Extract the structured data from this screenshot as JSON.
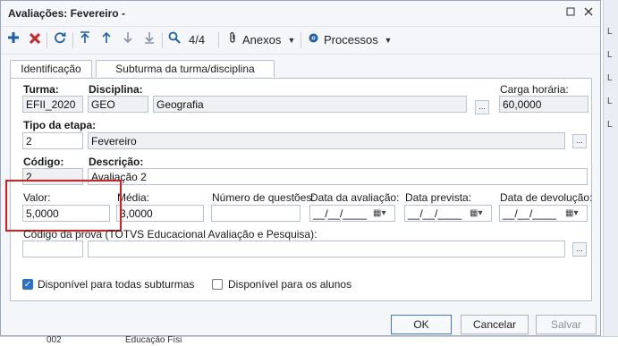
{
  "window": {
    "title": "Avaliações: Fevereiro -"
  },
  "titlebar": {
    "restore_icon": "restore-icon",
    "close_icon": "close-icon"
  },
  "toolbar": {
    "counter": "4/4",
    "anexos": "Anexos",
    "processos": "Processos"
  },
  "tabs": [
    {
      "label": "Identificação"
    },
    {
      "label": "Subturma da turma/disciplina"
    }
  ],
  "form": {
    "turma_label": "Turma:",
    "turma_value": "EFII_2020",
    "disciplina_label": "Disciplina:",
    "disciplina_code": "GEO",
    "disciplina_name": "Geografia",
    "carga_label": "Carga horária:",
    "carga_value": "60,0000",
    "tipo_label": "Tipo da etapa:",
    "tipo_code": "2",
    "tipo_name": "Fevereiro",
    "codigo_label": "Código:",
    "codigo_value": "2",
    "descricao_label": "Descrição:",
    "descricao_value": "Avaliação 2",
    "valor_label": "Valor:",
    "valor_value": "5,0000",
    "media_label": "Média:",
    "media_value": "3,0000",
    "numq_label": "Número de questões:",
    "numq_value": "",
    "data_aval_label": "Data da avaliação:",
    "data_aval_value": "__/__/____",
    "data_prev_label": "Data prevista:",
    "data_prev_value": "__/__/____",
    "data_dev_label": "Data de devolução:",
    "data_dev_value": "__/__/____",
    "codprova_label": "Código da prova (TOTVS Educacional Avaliação e Pesquisa):",
    "codprova_value": "",
    "codprova_desc": "",
    "chk_subturmas_label": "Disponível para todas subturmas",
    "chk_subturmas_checked": true,
    "chk_alunos_label": "Disponível para os alunos",
    "chk_alunos_checked": false,
    "lookup_dots": "..."
  },
  "buttons": {
    "ok": "OK",
    "cancel": "Cancelar",
    "save": "Salvar"
  },
  "background": {
    "right_letters": [
      "L",
      "L",
      "L",
      "L",
      "L"
    ],
    "bottom_code": "002",
    "bottom_text": "Educação Físi"
  },
  "colors": {
    "accent": "#2f6fc4",
    "highlight": "#e11b1b",
    "toolbar_icon": "#1f5fa8",
    "delete_icon": "#c62828"
  }
}
